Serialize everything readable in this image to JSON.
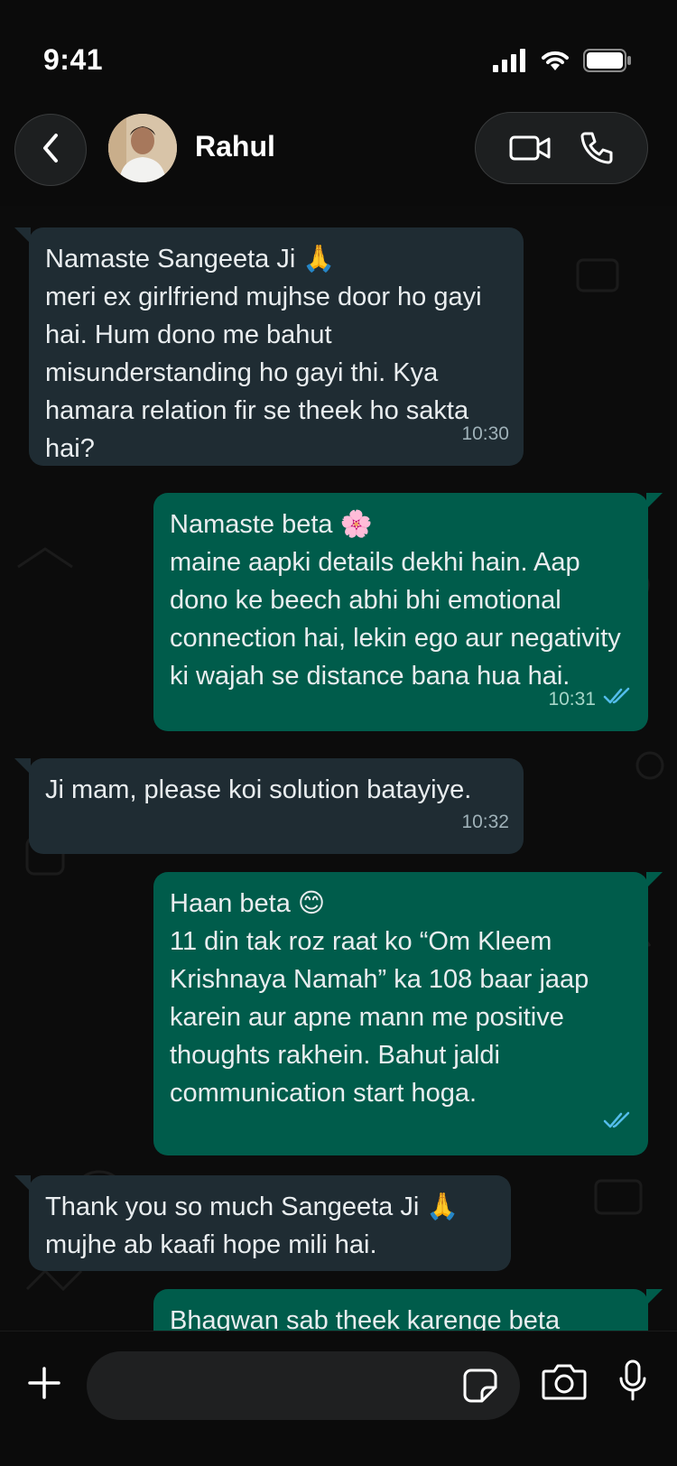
{
  "status_bar": {
    "time": "9:41"
  },
  "header": {
    "contact_name": "Rahul",
    "icons": {
      "back": "chevron-left-icon",
      "video": "video-call-icon",
      "voice": "phone-icon"
    }
  },
  "messages": [
    {
      "id": 1,
      "direction": "incoming",
      "text": "Namaste Sangeeta Ji 🙏\nmeri ex girlfriend mujhse door ho gayi hai. Hum dono me bahut misunderstanding ho gayi thi. Kya hamara relation fir se theek ho sakta hai?",
      "time": "10:30"
    },
    {
      "id": 2,
      "direction": "outgoing",
      "text": "Namaste beta 🌸\nmaine aapki details dekhi hain. Aap dono ke beech abhi bhi emotional connection hai, lekin ego aur negativity ki wajah se distance bana hua hai.",
      "time": "10:31",
      "read": true
    },
    {
      "id": 3,
      "direction": "incoming",
      "text": "Ji mam, please koi solution batayiye.",
      "time": "10:32"
    },
    {
      "id": 4,
      "direction": "outgoing",
      "text": "Haan beta 😊\n11 din tak roz raat ko “Om Kleem Krishnaya Namah” ka 108 baar jaap karein aur apne mann me positive thoughts rakhein. Bahut jaldi communication start hoga.",
      "time": "",
      "read": true
    },
    {
      "id": 5,
      "direction": "incoming",
      "text": "Thank you so much Sangeeta Ji 🙏\nmujhe ab kaafi hope mili hai.",
      "time": ""
    },
    {
      "id": 6,
      "direction": "outgoing",
      "text": "Bhagwan sab theek karenge beta",
      "time": ""
    }
  ],
  "composer": {
    "icons": {
      "add": "plus-icon",
      "sticker": "sticker-icon",
      "camera": "camera-icon",
      "mic": "microphone-icon"
    }
  },
  "colors": {
    "incoming_bubble": "#1f2c33",
    "outgoing_bubble": "#005c4b",
    "read_ticks": "#53bdeb",
    "background": "#0b0b0b"
  }
}
